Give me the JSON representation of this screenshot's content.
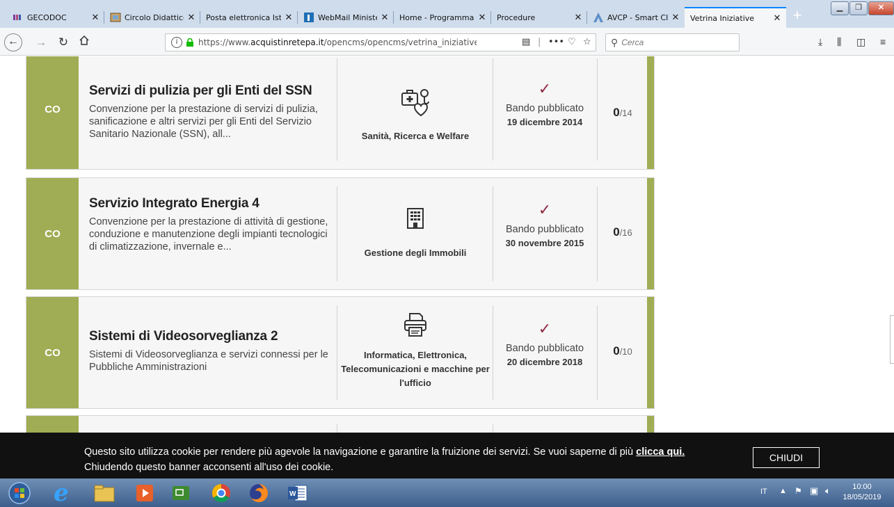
{
  "browser": {
    "tabs": [
      {
        "title": "GECODOC",
        "icon": "gecodoc-icon"
      },
      {
        "title": "Circolo Didattico",
        "icon": "school-icon"
      },
      {
        "title": "Posta elettronica Istru",
        "icon": ""
      },
      {
        "title": "WebMail Ministe",
        "icon": "webmail-icon"
      },
      {
        "title": "Home - Programma",
        "icon": ""
      },
      {
        "title": "Procedure",
        "icon": ""
      },
      {
        "title": "AVCP - Smart CI",
        "icon": "avcp-icon"
      },
      {
        "title": "Vetrina Iniziative",
        "icon": ""
      }
    ],
    "active_tab": 7,
    "url_prefix": "https://www.",
    "url_domain": "acquistinretepa.it",
    "url_path": "/opencms/opencms/vetrina_iniziative.html?fi",
    "search_placeholder": "Cerca"
  },
  "initiatives": [
    {
      "type": "CO",
      "title": "Servizi di pulizia per gli Enti del SSN",
      "description": "Convenzione per la prestazione di servizi di pulizia, sanificazione e altri servizi per gli Enti del Servizio Sanitario Nazionale (SSN), all...",
      "category": "Sanità, Ricerca e Welfare",
      "category_icon": "health-icon",
      "status": "Bando pubblicato",
      "date": "19 dicembre 2014",
      "count": "0",
      "total": "/14"
    },
    {
      "type": "CO",
      "title": "Servizio Integrato Energia 4",
      "description": "Convenzione per la prestazione di attività di gestione, conduzione e manutenzione degli impianti tecnologici di climatizzazione, invernale e...",
      "category": "Gestione degli Immobili",
      "category_icon": "building-icon",
      "status": "Bando pubblicato",
      "date": "30 novembre 2015",
      "count": "0",
      "total": "/16"
    },
    {
      "type": "CO",
      "title": "Sistemi di Videosorveglianza 2",
      "description": "Sistemi di Videosorveglianza e servizi connessi per le Pubbliche Amministrazioni",
      "category": "Informatica, Elettronica, Telecomunicazioni e macchine per l'ufficio",
      "category_icon": "printer-icon",
      "status": "Bando pubblicato",
      "date": "20 dicembre 2018",
      "count": "0",
      "total": "/10"
    }
  ],
  "cookie_banner": {
    "text_1": "Questo sito utilizza cookie per rendere più agevole la navigazione e garantire la fruizione dei servizi. Se vuoi saperne di più",
    "link": "clicca qui.",
    "text_2": "Chiudendo questo banner acconsenti all'uso dei cookie.",
    "close_label": "CHIUDI"
  },
  "taskbar": {
    "apps": [
      "start-orb-icon",
      "internet-explorer-icon",
      "file-explorer-icon",
      "media-player-icon",
      "remote-desktop-icon",
      "chrome-icon",
      "firefox-icon",
      "word-icon"
    ],
    "language": "IT",
    "time": "10:00",
    "date": "18/05/2019"
  },
  "colors": {
    "accent_green": "#a0ad54",
    "check_maroon": "#8f2b43",
    "firefox_blue": "#0a84ff"
  }
}
